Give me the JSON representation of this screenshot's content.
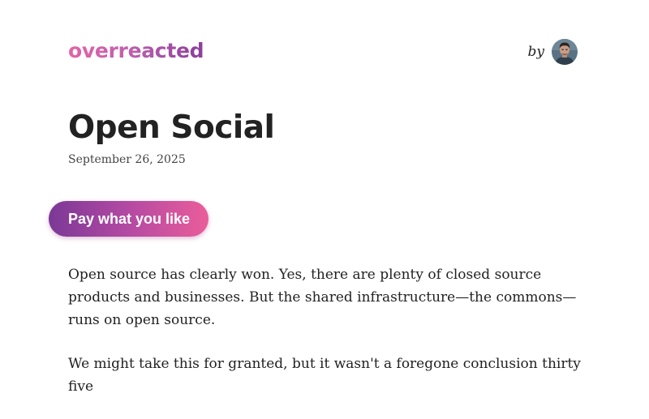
{
  "header": {
    "logo_text": "overreacted",
    "by_label": "by",
    "avatar_icon": "author-avatar"
  },
  "post": {
    "title": "Open Social",
    "date": "September 26, 2025",
    "cta_label": "Pay what you like",
    "paragraphs": [
      "Open source has clearly won. Yes, there are plenty of closed source products and businesses. But the shared infrastructure—the commons—runs on open source.",
      "We might take this for granted, but it wasn't a foregone conclusion thirty five"
    ]
  },
  "colors": {
    "logo_gradient": [
      "#e463a6",
      "#8a3e9c"
    ],
    "button_gradient": [
      "#7b3896",
      "#ea5d9a"
    ],
    "text": "#222222"
  }
}
